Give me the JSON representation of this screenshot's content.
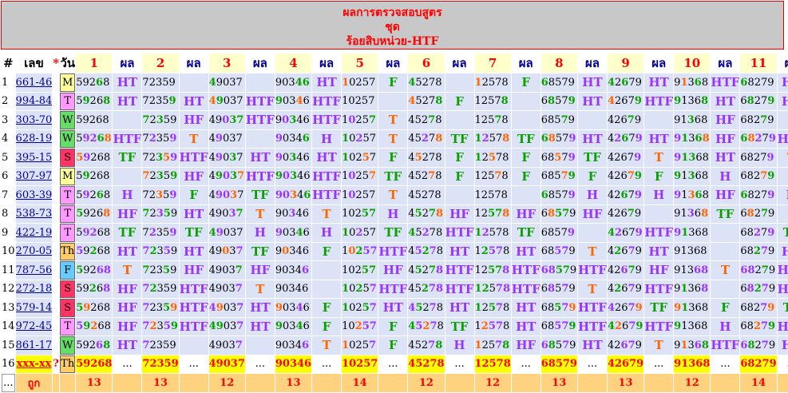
{
  "title": {
    "line1": "ผลการตรวจสอบสูตร",
    "line2": "ชุด",
    "line3": "ร้อยสิบหน่วย-HTF"
  },
  "header": {
    "hash": "#",
    "code": "เลข",
    "star": "*",
    "day": "วัน",
    "res": "ผล",
    "cols": [
      "1",
      "2",
      "3",
      "4",
      "5",
      "6",
      "7",
      "8",
      "9",
      "10",
      "11"
    ]
  },
  "rows": [
    {
      "n": "1",
      "code": "661-46",
      "day": "M",
      "dayColor": "#ffff99",
      "nums": [
        "59268",
        "72359",
        "49037",
        "90346",
        "10257",
        "45278",
        "12578",
        "68579",
        "42679",
        "91368",
        "68279"
      ],
      "res": [
        "HT",
        "",
        "",
        "HT",
        "F",
        "",
        "F",
        "HT",
        "HT",
        "HTF",
        "HT"
      ]
    },
    {
      "n": "2",
      "code": "994-84",
      "day": "T",
      "dayColor": "#ff99ff",
      "nums": [
        "59268",
        "72359",
        "49037",
        "90346",
        "10257",
        "45278",
        "12578",
        "68579",
        "42679",
        "91368",
        "68279"
      ],
      "res": [
        "HT",
        "HT",
        "HTF",
        "HTF",
        "",
        "F",
        "",
        "HT",
        "HTF",
        "HT",
        "HT"
      ]
    },
    {
      "n": "3",
      "code": "303-70",
      "day": "W",
      "dayColor": "#66dd66",
      "nums": [
        "59268",
        "72359",
        "49037",
        "90346",
        "10257",
        "45278",
        "12578",
        "68579",
        "42679",
        "91368",
        "68279"
      ],
      "res": [
        "",
        "HF",
        "HTF",
        "HTF",
        "T",
        "",
        "",
        "",
        "",
        "HF",
        ""
      ]
    },
    {
      "n": "4",
      "code": "628-19",
      "day": "W",
      "dayColor": "#66dd66",
      "nums": [
        "59268",
        "72359",
        "49037",
        "90346",
        "10257",
        "45278",
        "12578",
        "68579",
        "42679",
        "91368",
        "68279"
      ],
      "res": [
        "HTF",
        "T",
        "",
        "H",
        "T",
        "TF",
        "TF",
        "HT",
        "HT",
        "HF",
        "HTF"
      ]
    },
    {
      "n": "5",
      "code": "395-15",
      "day": "S",
      "dayColor": "#ff3366",
      "nums": [
        "59268",
        "72359",
        "49037",
        "90346",
        "10257",
        "45278",
        "12578",
        "68579",
        "42679",
        "91368",
        "68279"
      ],
      "res": [
        "TF",
        "HTF",
        "HT",
        "HT",
        "F",
        "F",
        "F",
        "TF",
        "T",
        "HT",
        "T"
      ]
    },
    {
      "n": "6",
      "code": "307-97",
      "day": "M",
      "dayColor": "#ffff99",
      "nums": [
        "59268",
        "72359",
        "49037",
        "90346",
        "10257",
        "45278",
        "12578",
        "68579",
        "42679",
        "91368",
        "68279"
      ],
      "res": [
        "",
        "HF",
        "HTF",
        "HTF",
        "TF",
        "F",
        "F",
        "F",
        "F",
        "H",
        "F"
      ]
    },
    {
      "n": "7",
      "code": "603-39",
      "day": "T",
      "dayColor": "#ff99ff",
      "nums": [
        "59268",
        "72359",
        "49037",
        "90346",
        "10257",
        "45278",
        "12578",
        "68579",
        "42679",
        "91368",
        "68279"
      ],
      "res": [
        "H",
        "F",
        "TF",
        "HTF",
        "T",
        "",
        "",
        "H",
        "H",
        "HF",
        "H"
      ]
    },
    {
      "n": "8",
      "code": "538-73",
      "day": "T",
      "dayColor": "#ff99ff",
      "nums": [
        "59268",
        "72359",
        "49037",
        "90346",
        "10257",
        "45278",
        "12578",
        "68579",
        "42679",
        "91368",
        "68279"
      ],
      "res": [
        "HF",
        "HT",
        "T",
        "T",
        "H",
        "HF",
        "HF",
        "HF",
        "",
        "TF",
        "F"
      ]
    },
    {
      "n": "9",
      "code": "422-19",
      "day": "T",
      "dayColor": "#ff99ff",
      "nums": [
        "59268",
        "72359",
        "49037",
        "90346",
        "10257",
        "45278",
        "12578",
        "68579",
        "42679",
        "91368",
        "68279"
      ],
      "res": [
        "TF",
        "TF",
        "H",
        "H",
        "TF",
        "HTF",
        "TF",
        "",
        "HTF",
        "",
        "TF"
      ]
    },
    {
      "n": "10",
      "code": "270-05",
      "day": "Th",
      "dayColor": "#ffcc66",
      "nums": [
        "59268",
        "72359",
        "49037",
        "90346",
        "10257",
        "45278",
        "12578",
        "68579",
        "42679",
        "91368",
        "68279"
      ],
      "res": [
        "HT",
        "HT",
        "TF",
        "F",
        "HTF",
        "HT",
        "HT",
        "T",
        "HT",
        "",
        "HT"
      ]
    },
    {
      "n": "11",
      "code": "787-56",
      "day": "F",
      "dayColor": "#66ccff",
      "nums": [
        "59268",
        "72359",
        "49037",
        "90346",
        "10257",
        "45278",
        "12578",
        "68579",
        "42679",
        "91368",
        "68279"
      ],
      "res": [
        "T",
        "HF",
        "HF",
        "",
        "HF",
        "HTF",
        "HTF",
        "HTF",
        "HF",
        "T",
        "HTF"
      ]
    },
    {
      "n": "12",
      "code": "272-18",
      "day": "S",
      "dayColor": "#ff3366",
      "nums": [
        "59268",
        "72359",
        "49037",
        "90346",
        "10257",
        "45278",
        "12578",
        "68579",
        "42679",
        "91368",
        "68279"
      ],
      "res": [
        "HF",
        "HTF",
        "T",
        "",
        "HTF",
        "HTF",
        "HTF",
        "T",
        "HTF",
        "",
        "HTF"
      ]
    },
    {
      "n": "13",
      "code": "579-14",
      "day": "S",
      "dayColor": "#ff3366",
      "nums": [
        "59268",
        "72359",
        "49037",
        "90346",
        "10257",
        "45278",
        "12578",
        "68579",
        "42679",
        "91368",
        "68279"
      ],
      "res": [
        "HF",
        "HTF",
        "HT",
        "F",
        "HT",
        "HT",
        "HT",
        "HTF",
        "TF",
        "F",
        "TF"
      ]
    },
    {
      "n": "14",
      "code": "972-45",
      "day": "T",
      "dayColor": "#ff99ff",
      "nums": [
        "59268",
        "72359",
        "49037",
        "90346",
        "10257",
        "45278",
        "12578",
        "68579",
        "42679",
        "91368",
        "68279"
      ],
      "res": [
        "HF",
        "HTF",
        "HT",
        "F",
        "F",
        "TF",
        "HT",
        "HTF",
        "HTF",
        "H",
        "HTF"
      ]
    },
    {
      "n": "15",
      "code": "861-17",
      "day": "W",
      "dayColor": "#66dd66",
      "nums": [
        "59268",
        "72359",
        "49037",
        "90346",
        "10257",
        "45278",
        "12578",
        "68579",
        "42679",
        "91368",
        "68279"
      ],
      "res": [
        "HT",
        "",
        "",
        "T",
        "F",
        "H",
        "HF",
        "HT",
        "T",
        "HTF",
        "HT"
      ]
    }
  ],
  "row16": {
    "n": "16",
    "code": "xxx-xx",
    "star": "?",
    "day": "Th",
    "nums": [
      "59268",
      "72359",
      "49037",
      "90346",
      "10257",
      "45278",
      "12578",
      "68579",
      "42679",
      "91368",
      "68279"
    ],
    "dot": "..."
  },
  "footer": {
    "dot": "...",
    "label": "ถูก",
    "counts": [
      "13",
      "13",
      "12",
      "13",
      "14",
      "12",
      "12",
      "13",
      "13",
      "12",
      "14"
    ]
  },
  "colors": {
    "title_bg": "#c8c8c8",
    "title_text": "#ff0000",
    "cell_bg": "#dde3f6",
    "highlight_row": "#ffff00",
    "footer_row": "#ffd27f"
  }
}
